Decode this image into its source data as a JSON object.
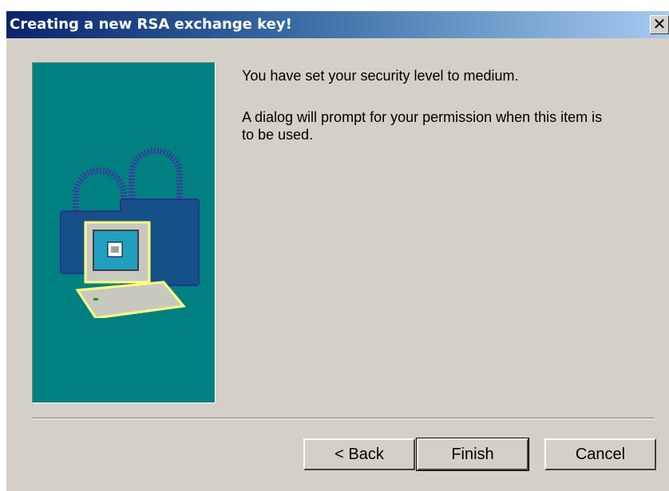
{
  "window": {
    "title": "Creating a new RSA exchange key!",
    "close_label": "✕"
  },
  "content": {
    "message_1": "You have set your security level to medium.",
    "message_2": "A dialog will prompt for your permission when this item is to be used."
  },
  "buttons": {
    "back": "< Back",
    "finish": "Finish",
    "cancel": "Cancel"
  },
  "icons": {
    "wizard_art": "padlock-computer-icon",
    "close": "close-icon"
  },
  "colors": {
    "title_start": "#0a246a",
    "title_end": "#a6caf0",
    "panel": "#008080",
    "face": "#d4d0c8"
  }
}
